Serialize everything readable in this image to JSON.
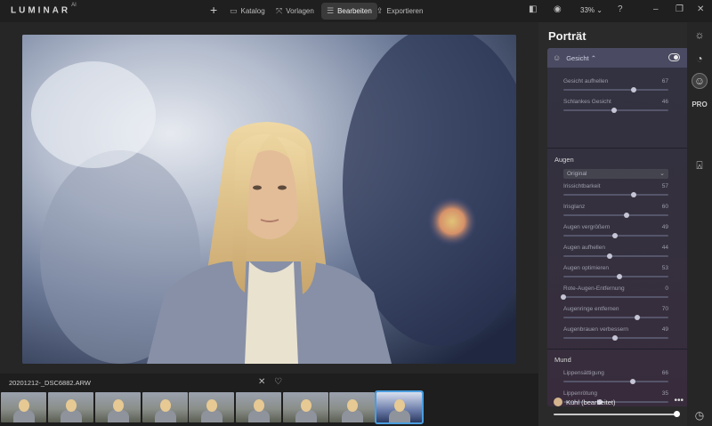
{
  "app": {
    "logo": "LUMINAR",
    "logo_suffix": "AI"
  },
  "topbar": {
    "add_label": "+",
    "nav": [
      {
        "label": "Katalog",
        "icon": "folder-icon"
      },
      {
        "label": "Vorlagen",
        "icon": "templates-icon"
      },
      {
        "label": "Bearbeiten",
        "icon": "edit-sliders-icon",
        "active": true
      },
      {
        "label": "Exportieren",
        "icon": "export-icon"
      }
    ],
    "zoom": "33%"
  },
  "filmstrip": {
    "filename": "20201212-_DSC6882.ARW",
    "selected_index": 8,
    "count": 9
  },
  "panel": {
    "title": "Porträt",
    "tool_name": "Gesicht",
    "sliders_face": [
      {
        "label": "Gesicht aufhellen",
        "value": "67",
        "fraction": 0.67
      },
      {
        "label": "Schlankes Gesicht",
        "value": "46",
        "fraction": 0.48
      }
    ],
    "eyes_title": "Augen",
    "eyes_select": "Original",
    "sliders_eyes": [
      {
        "label": "Irissichtbarkeit",
        "value": "57",
        "fraction": 0.67
      },
      {
        "label": "Irisglanz",
        "value": "60",
        "fraction": 0.6
      },
      {
        "label": "Augen vergrößern",
        "value": "49",
        "fraction": 0.49
      },
      {
        "label": "Augen aufhellen",
        "value": "44",
        "fraction": 0.44
      },
      {
        "label": "Augen optimieren",
        "value": "53",
        "fraction": 0.53
      },
      {
        "label": "Rote-Augen-Entfernung",
        "value": "0",
        "fraction": 0.0
      },
      {
        "label": "Augenringe entfernen",
        "value": "70",
        "fraction": 0.7
      },
      {
        "label": "Augenbrauen verbessern",
        "value": "49",
        "fraction": 0.49
      }
    ],
    "mouth_title": "Mund",
    "sliders_mouth": [
      {
        "label": "Lippensättigung",
        "value": "66",
        "fraction": 0.66
      },
      {
        "label": "Lippenrötung",
        "value": "35",
        "fraction": 0.35
      }
    ],
    "preset_name": "Kühl (bearbeitet)",
    "preset_more": "•••",
    "preset_amount": 1.0
  },
  "rail": {
    "pro_label": "PRO"
  },
  "colors": {
    "accent": "#4a9dde",
    "panel_section": "#4a4a62"
  }
}
